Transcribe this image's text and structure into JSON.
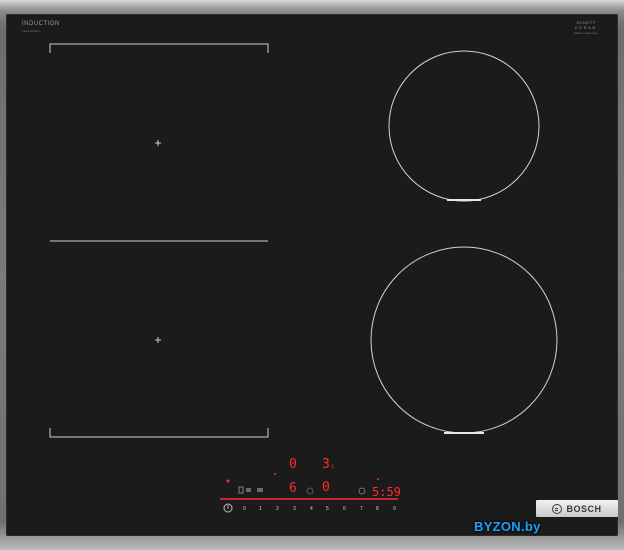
{
  "brand_left": {
    "title": "INDUCTION",
    "subtitle": "FlexInduction"
  },
  "brand_right": {
    "line1": "SCHOTT",
    "line2": "CERAN",
    "line3": "Made in Germany"
  },
  "display": {
    "top_left_digit": "0",
    "top_right_digit": "3",
    "top_right_suffix": "c",
    "mid_left_digit": "6",
    "mid_right_digit": "0",
    "timer": "5:59"
  },
  "slider": {
    "values": [
      "0",
      "1",
      "2",
      "3",
      "4",
      "5",
      "6",
      "7",
      "8",
      "9"
    ]
  },
  "badge": {
    "name": "BOSCH"
  },
  "watermark": {
    "text": "BYZON.by"
  },
  "colors": {
    "glass": "#1c1b1b",
    "display_red": "#ff2b2b",
    "zone_lines": "#cfcfcf"
  }
}
